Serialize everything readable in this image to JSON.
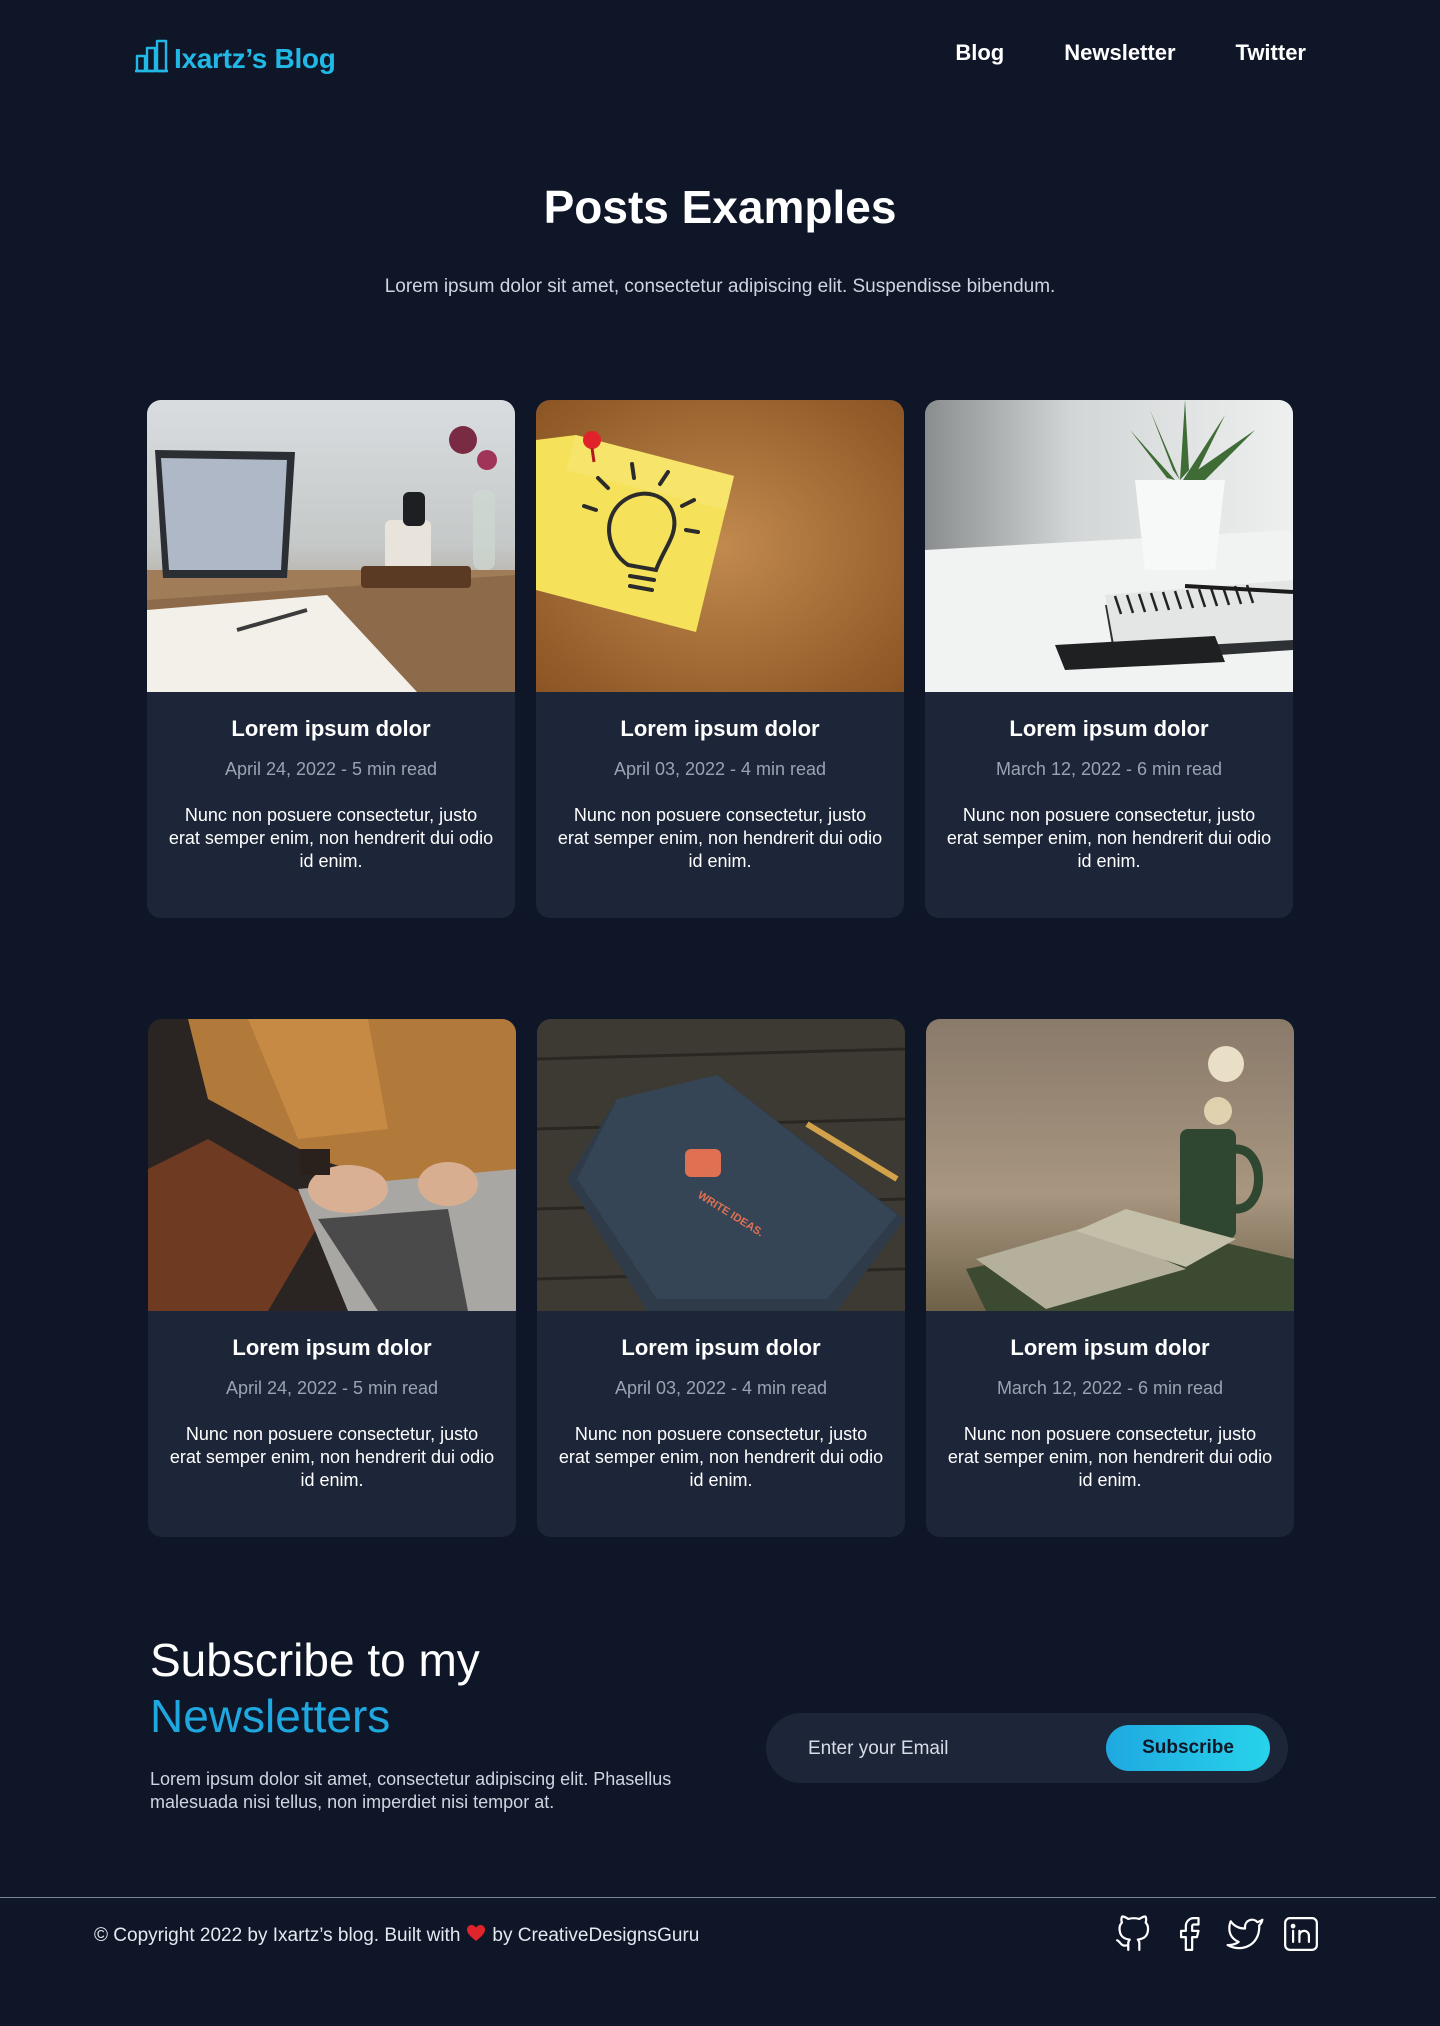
{
  "header": {
    "logo_text": "Ixartz’s Blog",
    "nav": [
      "Blog",
      "Newsletter",
      "Twitter"
    ]
  },
  "hero": {
    "title": "Posts Examples",
    "subtitle": "Lorem ipsum dolor sit amet, consectetur adipiscing elit. Suspendisse bibendum."
  },
  "posts": [
    {
      "title": "Lorem ipsum dolor",
      "meta": "April 24, 2022 - 5 min read",
      "excerpt": "Nunc non posuere consectetur, justo erat semper enim, non hendrerit dui odio id enim.",
      "image": "laptop-desk-photo"
    },
    {
      "title": "Lorem ipsum dolor",
      "meta": "April 03, 2022 - 4 min read",
      "excerpt": "Nunc non posuere consectetur, justo erat semper enim, non hendrerit dui odio id enim.",
      "image": "lightbulb-sticky-note-photo"
    },
    {
      "title": "Lorem ipsum dolor",
      "meta": "March 12, 2022 - 6 min read",
      "excerpt": "Nunc non posuere consectetur, justo erat semper enim, non hendrerit dui odio id enim.",
      "image": "notebook-plant-photo"
    },
    {
      "title": "Lorem ipsum dolor",
      "meta": "April 24, 2022 - 5 min read",
      "excerpt": "Nunc non posuere consectetur, justo erat semper enim, non hendrerit dui odio id enim.",
      "image": "person-typing-laptop-photo"
    },
    {
      "title": "Lorem ipsum dolor",
      "meta": "April 03, 2022 - 4 min read",
      "excerpt": "Nunc non posuere consectetur, justo erat semper enim, non hendrerit dui odio id enim.",
      "image": "write-ideas-notebook-photo",
      "image_text": "WRITE IDEAS."
    },
    {
      "title": "Lorem ipsum dolor",
      "meta": "March 12, 2022 - 6 min read",
      "excerpt": "Nunc non posuere consectetur, justo erat semper enim, non hendrerit dui odio id enim.",
      "image": "coffee-book-photo"
    }
  ],
  "subscribe": {
    "heading_line1": "Subscribe to my",
    "heading_accent": "Newsletters",
    "text": "Lorem ipsum dolor sit amet, consectetur adipiscing elit. Phasellus malesuada nisi tellus, non imperdiet nisi tempor at.",
    "email_placeholder": "Enter your Email",
    "button_label": "Subscribe"
  },
  "footer": {
    "copyright_pre": "© Copyright 2022 by Ixartz’s blog. Built with",
    "copyright_post": "by CreativeDesignsGuru",
    "socials": [
      "github-icon",
      "facebook-icon",
      "twitter-icon",
      "linkedin-icon"
    ]
  },
  "colors": {
    "background": "#0f1628",
    "card": "#1d2638",
    "accent": "#1fa8e0",
    "heart": "#e0242c"
  }
}
